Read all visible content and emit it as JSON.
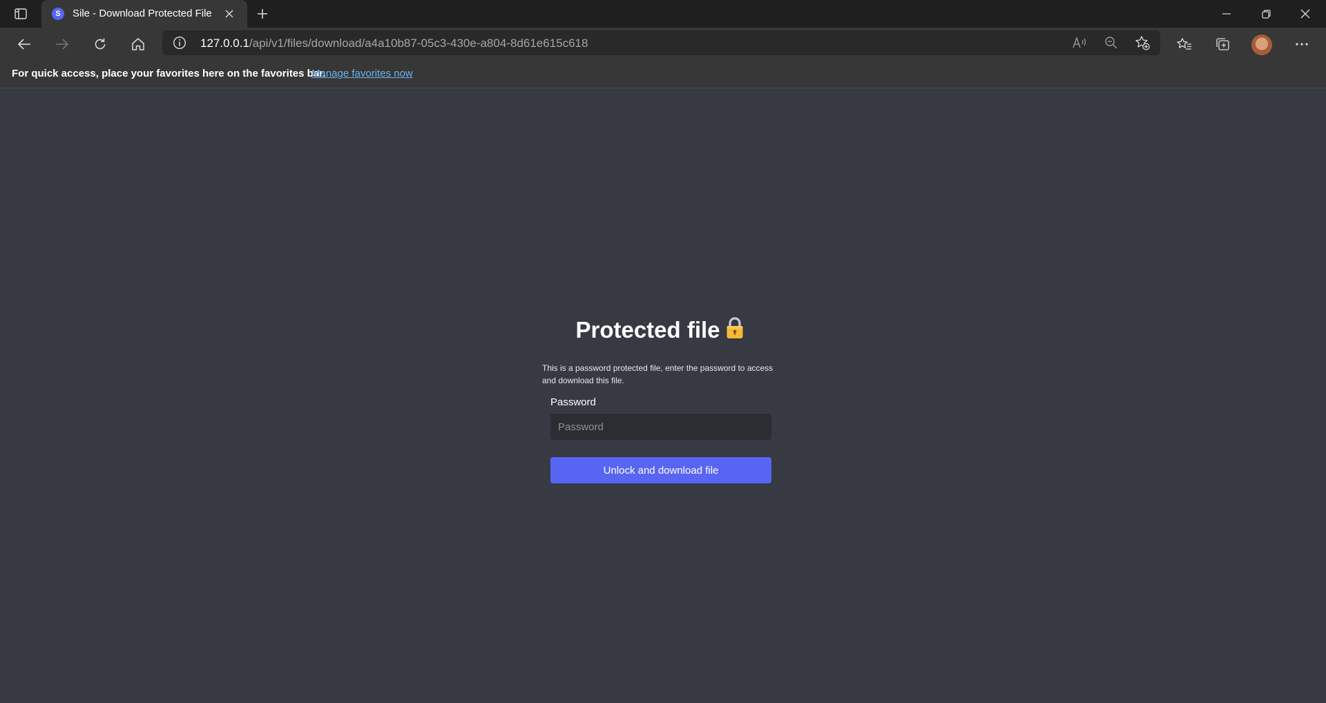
{
  "browser": {
    "tab": {
      "favicon_letter": "S",
      "title": "Sile - Download Protected File"
    },
    "address": {
      "host": "127.0.0.1",
      "path": "/api/v1/files/download/a4a10b87-05c3-430e-a804-8d61e615c618"
    },
    "favorites_bar": {
      "message": "For quick access, place your favorites here on the favorites bar.",
      "link": "Manage favorites now"
    }
  },
  "page": {
    "heading": "Protected file",
    "heading_emoji": "🔒",
    "description": "This is a password protected file, enter the password to access and download this file.",
    "password_label": "Password",
    "password_placeholder": "Password",
    "password_value": "",
    "submit_label": "Unlock and download file"
  },
  "colors": {
    "page_background": "#373a43",
    "accent": "#5865f2",
    "link": "#6cb2f2"
  }
}
